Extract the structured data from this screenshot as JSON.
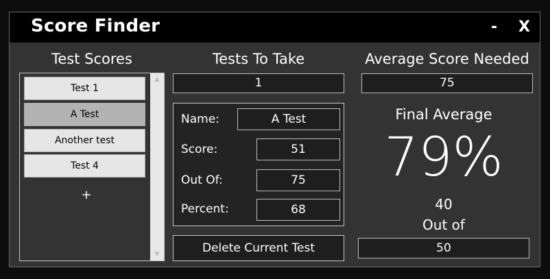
{
  "window": {
    "title": "Score Finder",
    "minimize_label": "-",
    "close_label": "X"
  },
  "test_scores": {
    "heading": "Test Scores",
    "items": [
      {
        "label": "Test 1",
        "selected": false
      },
      {
        "label": "A Test",
        "selected": true
      },
      {
        "label": "Another test",
        "selected": false
      },
      {
        "label": "Test 4",
        "selected": false
      }
    ],
    "add_label": "+"
  },
  "tests_to_take": {
    "heading": "Tests To Take",
    "value": "1"
  },
  "details": {
    "name_label": "Name:",
    "name_value": "A Test",
    "score_label": "Score:",
    "score_value": "51",
    "out_of_label": "Out Of:",
    "out_of_value": "75",
    "percent_label": "Percent:",
    "percent_value": "68"
  },
  "delete_button_label": "Delete Current Test",
  "average_needed": {
    "heading": "Average Score Needed",
    "value": "75"
  },
  "final_average": {
    "heading": "Final Average",
    "value": "79%",
    "points": "40",
    "out_of_label": "Out of",
    "out_of_value": "50"
  },
  "colors": {
    "window_bg": "#333333",
    "titlebar_bg": "#000000",
    "field_bg": "#1e1e1e",
    "list_item_bg": "#e6e6e6",
    "list_item_selected_bg": "#b3b3b3"
  }
}
